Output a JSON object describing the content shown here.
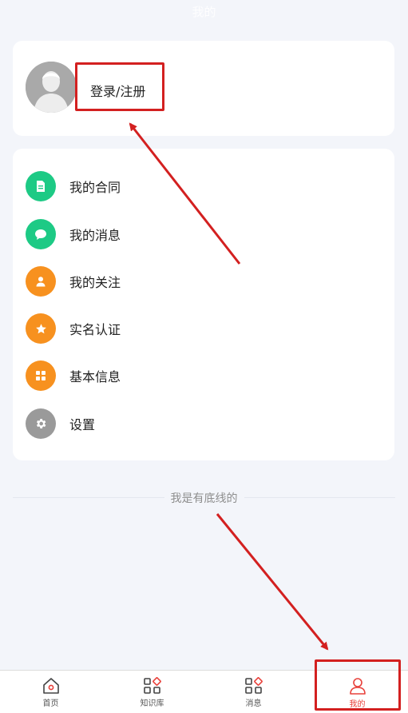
{
  "header": {
    "title": "我的"
  },
  "profile": {
    "login_label": "登录/注册"
  },
  "menu": {
    "items": [
      {
        "label": "我的合同",
        "icon": "document-icon",
        "color": "#1dca85"
      },
      {
        "label": "我的消息",
        "icon": "chat-bubble-icon",
        "color": "#1dca85"
      },
      {
        "label": "我的关注",
        "icon": "user-icon",
        "color": "#f7911f"
      },
      {
        "label": "实名认证",
        "icon": "star-icon",
        "color": "#f7911f"
      },
      {
        "label": "基本信息",
        "icon": "grid-icon",
        "color": "#f7911f"
      },
      {
        "label": "设置",
        "icon": "gear-icon",
        "color": "#9a9a9a"
      }
    ]
  },
  "footer": {
    "text": "我是有底线的"
  },
  "tabbar": {
    "tabs": [
      {
        "label": "首页",
        "icon": "home-icon"
      },
      {
        "label": "知识库",
        "icon": "knowledge-icon"
      },
      {
        "label": "消息",
        "icon": "message-icon"
      },
      {
        "label": "我的",
        "icon": "profile-icon",
        "active": true
      }
    ]
  },
  "colors": {
    "accent": "#e8403a",
    "annotation": "#d32020"
  }
}
